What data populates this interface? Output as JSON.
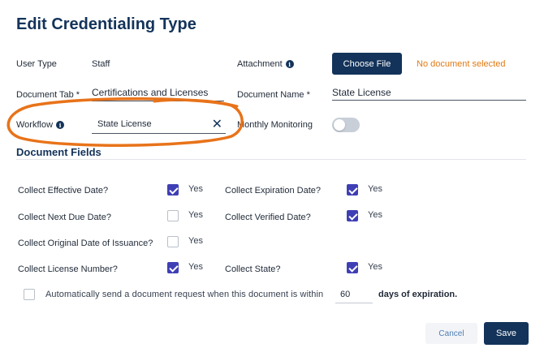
{
  "page": {
    "title": "Edit Credentialing Type"
  },
  "form": {
    "user_type_label": "User Type",
    "user_type_value": "Staff",
    "attachment_label": "Attachment",
    "choose_file_label": "Choose File",
    "no_document_text": "No document selected",
    "document_tab_label": "Document Tab *",
    "document_tab_value": "Certifications and Licenses",
    "document_name_label": "Document Name *",
    "document_name_value": "State License",
    "workflow_label": "Workflow",
    "workflow_value": "State License",
    "monthly_monitoring_label": "Monthly Monitoring",
    "monthly_monitoring_on": false
  },
  "fields": {
    "section_title": "Document Fields",
    "yes_label": "Yes",
    "items": [
      {
        "label": "Collect Effective Date?",
        "checked": true
      },
      {
        "label": "Collect Expiration Date?",
        "checked": true
      },
      {
        "label": "Collect Next Due Date?",
        "checked": false
      },
      {
        "label": "Collect Verified Date?",
        "checked": true
      },
      {
        "label": "Collect Original Date of Issuance?",
        "checked": false
      },
      {
        "label": "Collect License Number?",
        "checked": true
      },
      {
        "label": "Collect State?",
        "checked": true
      }
    ]
  },
  "auto_request": {
    "checked": false,
    "text_before": "Automatically send a document request when this document is within",
    "days": "60",
    "text_after": "days of expiration."
  },
  "footer": {
    "cancel_label": "Cancel",
    "save_label": "Save"
  },
  "colors": {
    "primary": "#13335a",
    "accent_checkbox": "#3f3fb5",
    "warning": "#e07a13",
    "annotation": "#e8731a"
  }
}
